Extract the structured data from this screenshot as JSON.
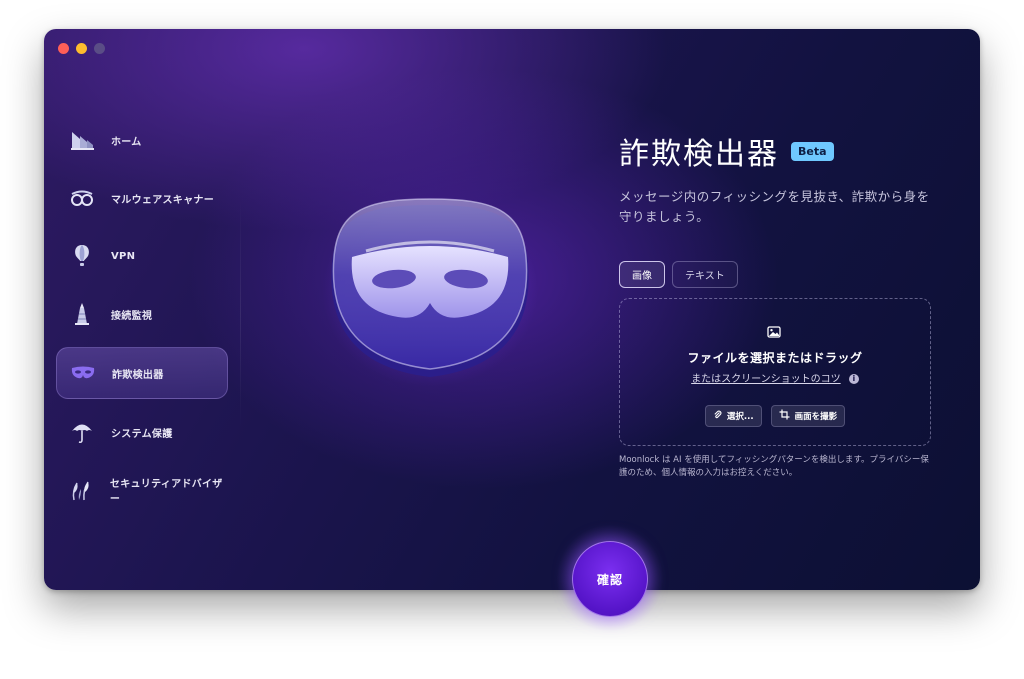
{
  "sidebar": {
    "items": [
      {
        "label": "ホーム",
        "icon": "home-icon"
      },
      {
        "label": "マルウェアスキャナー",
        "icon": "malware-scanner-icon"
      },
      {
        "label": "VPN",
        "icon": "vpn-balloon-icon"
      },
      {
        "label": "接続監視",
        "icon": "connection-monitor-icon"
      },
      {
        "label": "詐欺検出器",
        "icon": "mask-icon",
        "active": true
      },
      {
        "label": "システム保護",
        "icon": "umbrella-icon"
      },
      {
        "label": "セキュリティアドバイザー",
        "icon": "advisor-icon"
      }
    ]
  },
  "main": {
    "title": "詐欺検出器",
    "badge": "Beta",
    "subtitle": "メッセージ内のフィッシングを見抜き、詐欺から身を守りましょう。",
    "tabs": [
      {
        "label": "画像",
        "active": true
      },
      {
        "label": "テキスト",
        "active": false
      }
    ],
    "dropzone": {
      "icon": "image-icon",
      "main_text": "ファイルを選択またはドラッグ",
      "tips_link": "またはスクリーンショットのコツ",
      "info_glyph": "i",
      "choose_label": "選択...",
      "capture_label": "画面を撮影"
    },
    "disclaimer": "Moonlock は AI を使用してフィッシングパターンを検出します。プライバシー保護のため、個人情報の入力はお控えください。"
  },
  "confirm_label": "確認",
  "colors": {
    "accent": "#6a22e0",
    "beta_badge": "#6fc8ff",
    "window_bg": "#1b1650"
  }
}
